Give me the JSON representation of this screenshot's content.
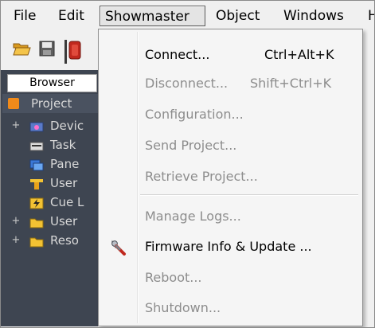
{
  "menubar": {
    "items": [
      "File",
      "Edit",
      "Showmaster",
      "Object",
      "Windows",
      "H"
    ]
  },
  "toolbar": {
    "icons": [
      "open-folder-icon",
      "save-icon",
      "red-app-icon"
    ]
  },
  "left_panel": {
    "browser_tab": "Browser",
    "project_label": "Project",
    "tree": [
      {
        "label": "Devic",
        "expandable": true,
        "icon": "devices-icon"
      },
      {
        "label": "Task",
        "expandable": false,
        "icon": "tasks-icon"
      },
      {
        "label": "Pane",
        "expandable": false,
        "icon": "panels-icon"
      },
      {
        "label": "User",
        "expandable": false,
        "icon": "user-variables-icon"
      },
      {
        "label": "Cue L",
        "expandable": false,
        "icon": "cue-lists-icon"
      },
      {
        "label": "User",
        "expandable": true,
        "icon": "folder-icon"
      },
      {
        "label": "Reso",
        "expandable": true,
        "icon": "folder-icon"
      }
    ],
    "expander_glyph": "+"
  },
  "dropdown": {
    "items": [
      {
        "label": "Connect...",
        "shortcut": "Ctrl+Alt+K",
        "enabled": true
      },
      {
        "label": "Disconnect...",
        "shortcut": "Shift+Ctrl+K",
        "enabled": false
      },
      {
        "label": "Configuration...",
        "shortcut": "",
        "enabled": false
      },
      {
        "label": "Send Project...",
        "shortcut": "",
        "enabled": false
      },
      {
        "label": "Retrieve Project...",
        "shortcut": "",
        "enabled": false
      },
      {
        "label": "Manage Logs...",
        "shortcut": "",
        "enabled": false
      },
      {
        "label": "Firmware Info & Update ...",
        "shortcut": "",
        "enabled": true,
        "icon": "wrench-icon"
      },
      {
        "label": "Reboot...",
        "shortcut": "",
        "enabled": false
      },
      {
        "label": "Shutdown...",
        "shortcut": "",
        "enabled": false
      }
    ]
  },
  "colors": {
    "panel_bg": "#3e4551",
    "menu_bg": "#f5f5f5",
    "disabled_text": "#8d8d8d",
    "accent_orange": "#f08a1a"
  }
}
